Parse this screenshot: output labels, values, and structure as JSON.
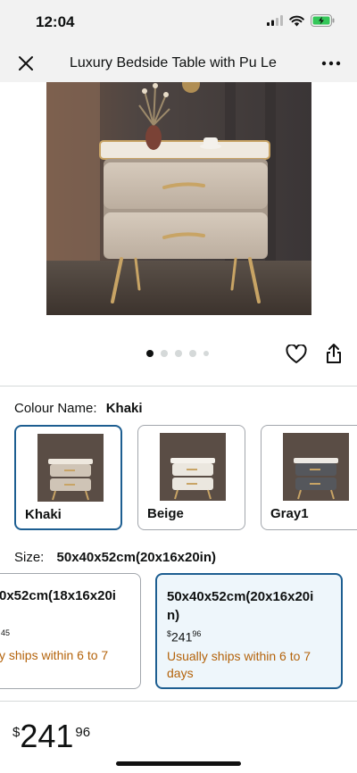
{
  "status": {
    "time": "12:04"
  },
  "nav": {
    "title": "Luxury Bedside Table with Pu Le"
  },
  "gallery": {
    "image_count": 5,
    "active_index": 0
  },
  "colour": {
    "label": "Colour Name:",
    "selected": "Khaki",
    "options": [
      {
        "name": "Khaki",
        "drawer_color": "#cfc4b6"
      },
      {
        "name": "Beige",
        "drawer_color": "#ebe7df"
      },
      {
        "name": "Gray1",
        "drawer_color": "#55575c"
      }
    ]
  },
  "size": {
    "label": "Size:",
    "selected": "50x40x52cm(20x16x20in)",
    "options": [
      {
        "name": "0x52cm(18x16x20i",
        "price": "45",
        "shipping": "y ships within 6 to 7"
      },
      {
        "name_line1": "50x40x52cm(20x16x20i",
        "name_line2": "n)",
        "price_symbol": "$",
        "price_whole": "241",
        "price_frac": "96",
        "shipping_line1": "Usually ships within 6 to 7",
        "shipping_line2": "days"
      }
    ]
  },
  "price": {
    "symbol": "$",
    "whole": "241",
    "fraction": "96"
  },
  "colors": {
    "accent": "#1d5e91",
    "shipping": "#b4630b",
    "battery": "#34c759"
  }
}
